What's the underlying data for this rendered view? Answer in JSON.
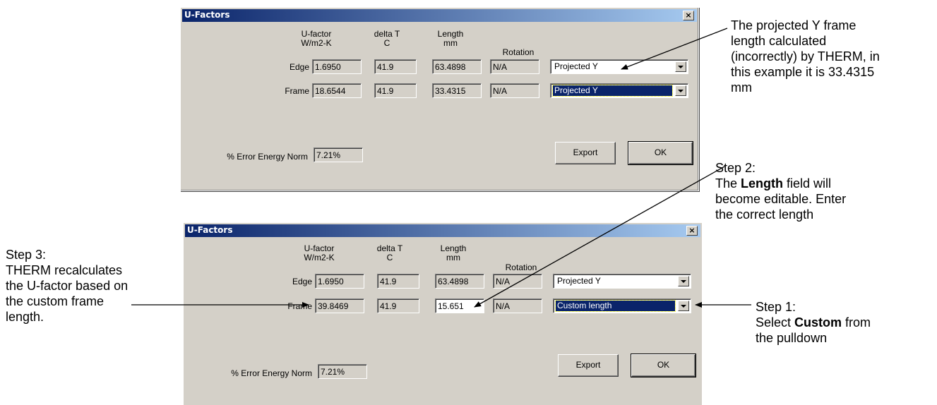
{
  "dialogs": [
    {
      "title": "U-Factors",
      "close": "×",
      "headers": {
        "ufactor": "U-factor",
        "ufactor_unit": "W/m2-K",
        "deltat": "delta T",
        "deltat_unit": "C",
        "length": "Length",
        "length_unit": "mm",
        "rotation": "Rotation"
      },
      "rows": [
        {
          "label": "Edge",
          "ufactor": "1.6950",
          "deltat": "41.9",
          "length": "63.4898",
          "rotation": "N/A",
          "select": "Projected Y"
        },
        {
          "label": "Frame",
          "ufactor": "18.6544",
          "deltat": "41.9",
          "length": "33.4315",
          "rotation": "N/A",
          "select": "Projected Y"
        }
      ],
      "error_label": "% Error Energy Norm",
      "error_value": "7.21%",
      "export": "Export",
      "ok": "OK"
    },
    {
      "title": "U-Factors",
      "close": "×",
      "headers": {
        "ufactor": "U-factor",
        "ufactor_unit": "W/m2-K",
        "deltat": "delta T",
        "deltat_unit": "C",
        "length": "Length",
        "length_unit": "mm",
        "rotation": "Rotation"
      },
      "rows": [
        {
          "label": "Edge",
          "ufactor": "1.6950",
          "deltat": "41.9",
          "length": "63.4898",
          "rotation": "N/A",
          "select": "Projected Y"
        },
        {
          "label": "Frame",
          "ufactor": "39.8469",
          "deltat": "41.9",
          "length": "15.651",
          "rotation": "N/A",
          "select": "Custom length"
        }
      ],
      "error_label": "% Error Energy Norm",
      "error_value": "7.21%",
      "export": "Export",
      "ok": "OK"
    }
  ],
  "annotations": {
    "projected": [
      "The projected Y frame",
      "length calculated",
      "(incorrectly) by THERM, in",
      "this example it is 33.4315",
      "mm"
    ],
    "step2_title": "Step 2:",
    "step2_pre": "The ",
    "step2_bold": "Length",
    "step2_post": " field will",
    "step2_lines": [
      "become editable. Enter",
      "the correct length"
    ],
    "step3": [
      "Step 3:",
      "THERM recalculates",
      "the U-factor based on",
      "the custom frame",
      "length."
    ],
    "step1_title": "Step 1:",
    "step1_pre": "Select ",
    "step1_bold": "Custom",
    "step1_post": " from",
    "step1_line3": "the pulldown"
  },
  "colors": {
    "titlebar_start": "#0a246a",
    "titlebar_end": "#a6caf0",
    "dialog_face": "#d4d0c8",
    "selection": "#0a246a"
  }
}
